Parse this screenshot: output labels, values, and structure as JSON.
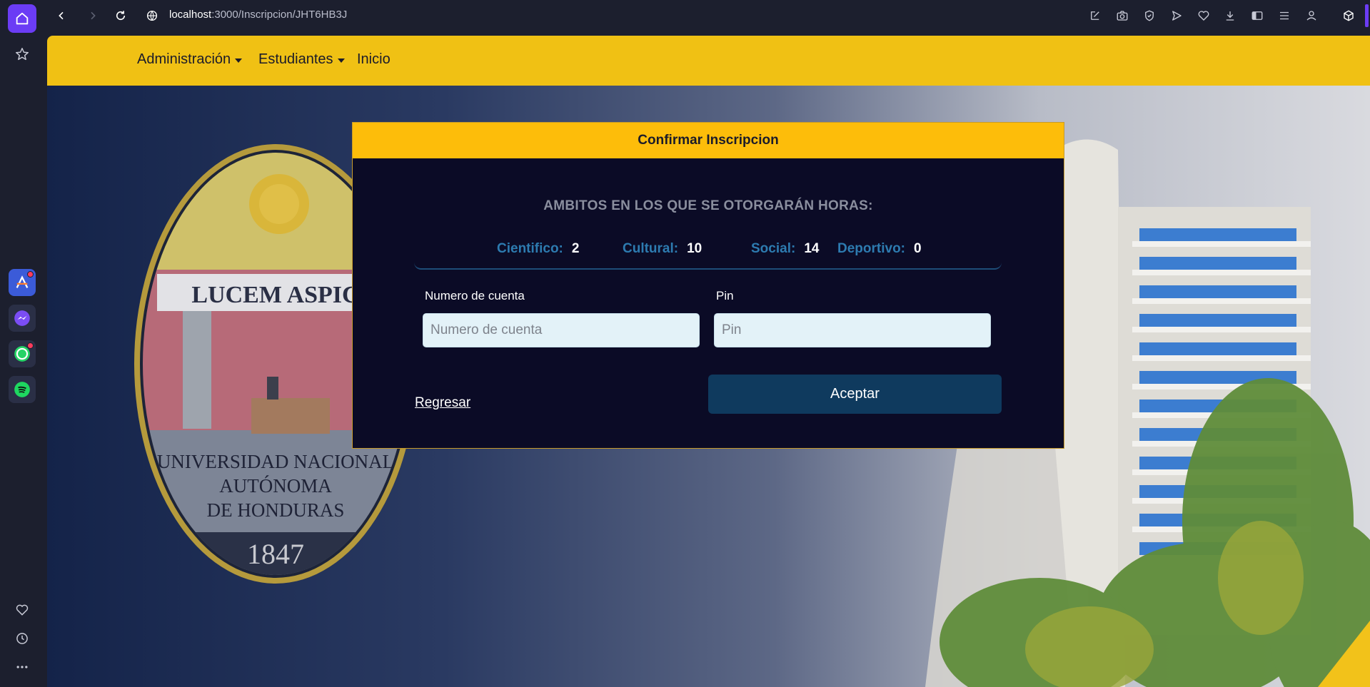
{
  "browser": {
    "url_host": "localhost",
    "url_rest": ":3000/Inscripcion/JHT6HB3J"
  },
  "nav": {
    "items": [
      {
        "label": "Administración",
        "dropdown": true
      },
      {
        "label": "Estudiantes",
        "dropdown": true
      },
      {
        "label": "Inicio",
        "dropdown": false
      }
    ]
  },
  "modal": {
    "title": "Confirmar Inscripcion",
    "ambitos_heading": "AMBITOS EN LOS QUE SE OTORGARÁN HORAS:",
    "stats": [
      {
        "label": "Cientifico:",
        "value": "2"
      },
      {
        "label": "Cultural:",
        "value": "10"
      },
      {
        "label": "Social:",
        "value": "14"
      },
      {
        "label": "Deportivo:",
        "value": "0"
      }
    ],
    "account_label": "Numero de cuenta",
    "account_placeholder": "Numero de cuenta",
    "pin_label": "Pin",
    "pin_placeholder": "Pin",
    "back_label": "Regresar",
    "accept_label": "Aceptar"
  },
  "seal": {
    "motto": "LUCEM ASPIC",
    "line1": "UNIVERSIDAD NACIONAL",
    "line2": "AUTÓNOMA",
    "line3": "DE HONDURAS",
    "year": "1847"
  },
  "colors": {
    "nav_bg": "#f0c114",
    "modal_header": "#fdbd0a",
    "modal_bg": "#0b0b26",
    "accent_label": "#2d7bb0",
    "button_bg": "#0f3a5e"
  }
}
